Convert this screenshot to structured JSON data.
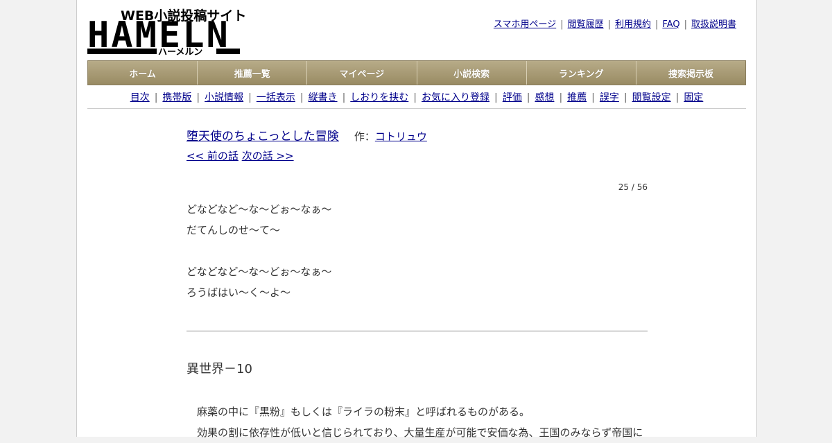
{
  "logo": {
    "subtitle": "WEB小説投稿サイト",
    "main": "HAMELN",
    "kana": "ハーメルン"
  },
  "top_links": [
    "スマホ用ページ",
    "閲覧履歴",
    "利用規約",
    "FAQ",
    "取扱説明書"
  ],
  "main_nav": [
    "ホーム",
    "推薦一覧",
    "マイページ",
    "小説検索",
    "ランキング",
    "捜索掲示板"
  ],
  "sub_nav": [
    "目次",
    "携帯版",
    "小説情報",
    "一括表示",
    "縦書き",
    "しおりを挟む",
    "お気に入り登録",
    "評価",
    "感想",
    "推薦",
    "誤字",
    "閲覧設定",
    "固定"
  ],
  "novel": {
    "title": "堕天使のちょこっとした冒険",
    "author_prefix": "作：",
    "author": "コトリュウ",
    "prev": "<< 前の話",
    "next": "次の話 >>",
    "page_count": "25 / 56"
  },
  "lyrics": [
    "どなどなど～な～どぉ～なぁ～",
    "だてんしのせ～て～",
    "",
    "どなどなど～な～どぉ～なぁ～",
    "ろうばはい～く～よ～"
  ],
  "chapter_title": "異世界－10",
  "body": [
    "麻薬の中に『黒粉』もしくは『ライラの粉末』と呼ばれるものがある。",
    "効果の割に依存性が低いと信じられており、大量生産が可能で安価な為、王国のみならず帝国に"
  ]
}
